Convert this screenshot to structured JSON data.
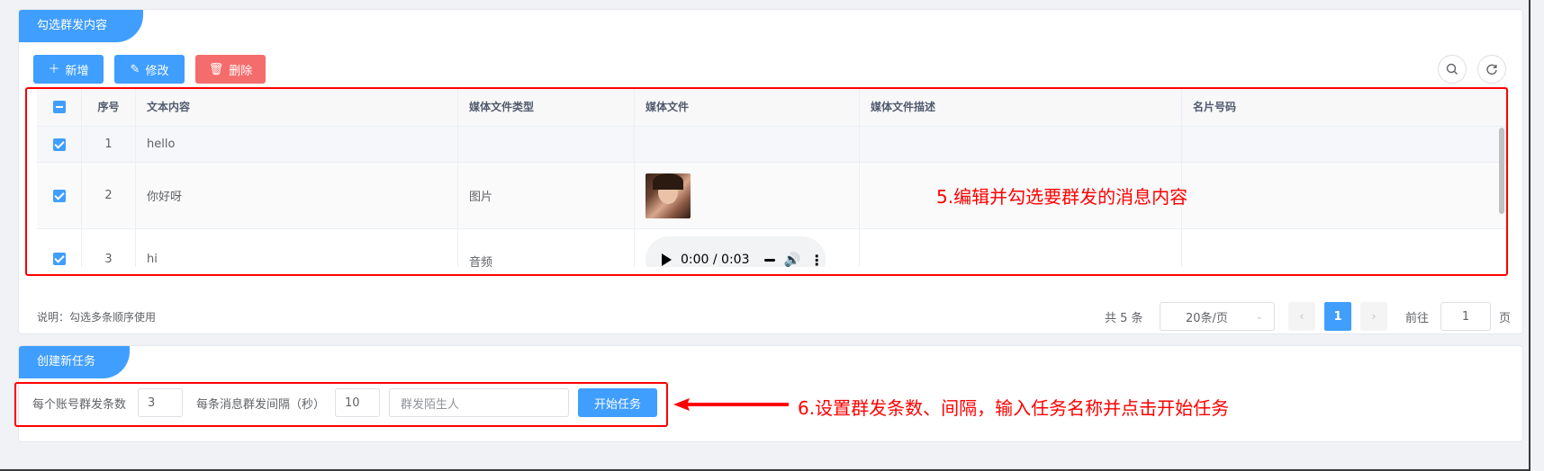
{
  "card1": {
    "title": "勾选群发内容",
    "toolbar": {
      "add_label": "新增",
      "edit_label": "修改",
      "delete_label": "删除"
    },
    "table": {
      "headers": [
        "序号",
        "文本内容",
        "媒体文件类型",
        "媒体文件",
        "媒体文件描述",
        "名片号码"
      ],
      "rows": [
        {
          "index": "1",
          "text": "hello",
          "media_type": "",
          "media": "",
          "desc": "",
          "card": ""
        },
        {
          "index": "2",
          "text": "你好呀",
          "media_type": "图片",
          "media": "image-thumbnail",
          "desc": "",
          "card": ""
        },
        {
          "index": "3",
          "text": "hi",
          "media_type": "音频",
          "media": "audio-player",
          "desc": "",
          "card": ""
        }
      ],
      "audio_time": "0:00 / 0:03"
    },
    "note": "说明：勾选多条顺序使用",
    "pagination": {
      "total": "共 5 条",
      "page_size": "20条/页",
      "current_page": "1",
      "goto_label": "前往",
      "goto_value": "1",
      "page_unit": "页"
    }
  },
  "card2": {
    "title": "创建新任务",
    "form": {
      "count_label": "每个账号群发条数",
      "count_value": "3",
      "interval_label": "每条消息群发间隔（秒）",
      "interval_value": "10",
      "task_name_placeholder": "群发陌生人",
      "start_button": "开始任务"
    }
  },
  "annotations": {
    "step5": "5.编辑并勾选要群发的消息内容",
    "step6": "6.设置群发条数、间隔，输入任务名称并点击开始任务"
  },
  "colors": {
    "primary": "#409eff",
    "danger": "#f56c6c",
    "annotation": "#ff0000"
  }
}
